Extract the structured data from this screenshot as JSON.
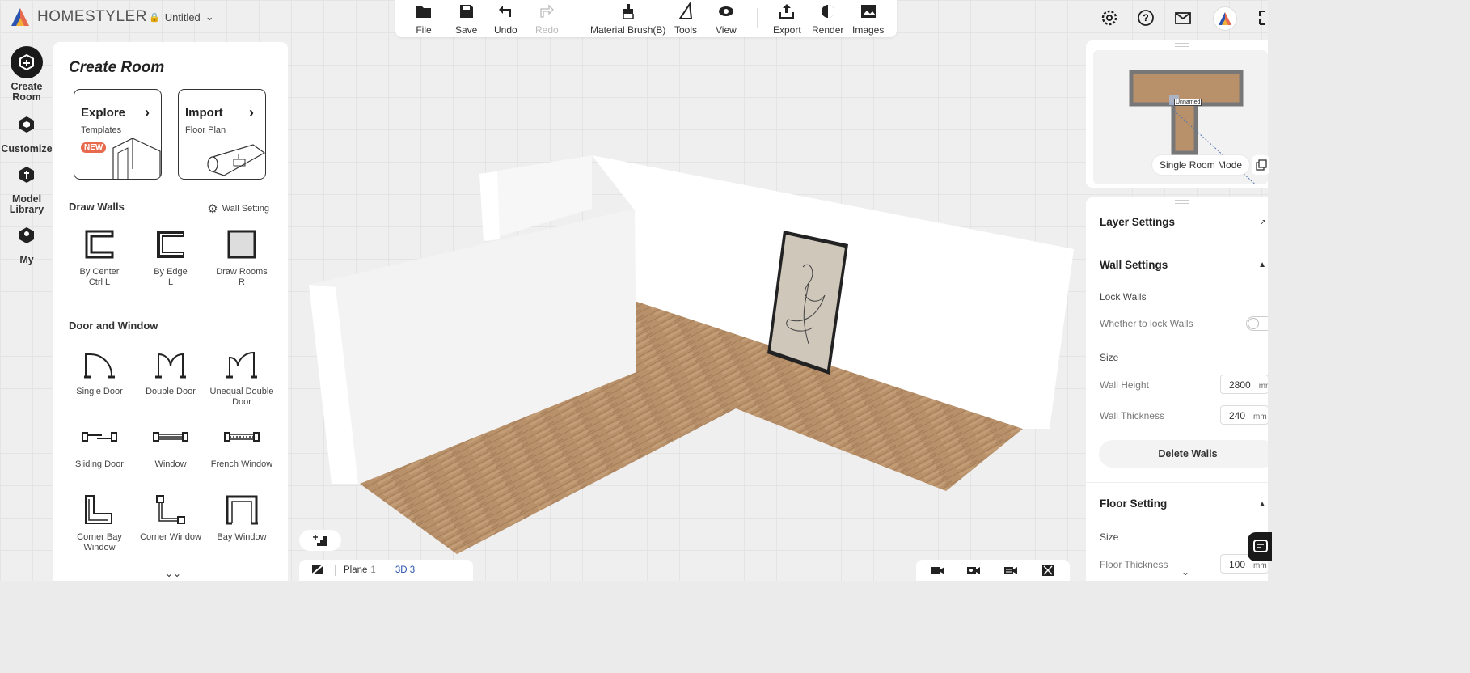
{
  "brand": {
    "name": "HOMESTYLER",
    "doc_title": "Untitled"
  },
  "toolbar": {
    "file": "File",
    "save": "Save",
    "undo": "Undo",
    "redo": "Redo",
    "material_brush": "Material Brush(B)",
    "tools": "Tools",
    "view": "View",
    "export": "Export",
    "render": "Render",
    "images": "Images"
  },
  "rail": [
    {
      "label": "Create Room",
      "icon": "create-room-icon"
    },
    {
      "label": "Customize",
      "icon": "cube-icon"
    },
    {
      "label": "Model Library",
      "icon": "model-library-icon"
    },
    {
      "label": "My",
      "icon": "user-icon"
    }
  ],
  "panel": {
    "title": "Create Room",
    "explore": {
      "title": "Explore",
      "sub": "Templates",
      "badge": "NEW"
    },
    "import": {
      "title": "Import",
      "sub": "Floor Plan"
    },
    "draw_walls": "Draw Walls",
    "wall_setting": "Wall Setting",
    "wall_tools": [
      {
        "label": "By Center",
        "shortcut": "Ctrl L"
      },
      {
        "label": "By Edge",
        "shortcut": "L"
      },
      {
        "label": "Draw Rooms",
        "shortcut": "R"
      }
    ],
    "door_window": "Door and Window",
    "dw_tools": [
      {
        "label": "Single Door"
      },
      {
        "label": "Double Door"
      },
      {
        "label": "Unequal Double Door"
      },
      {
        "label": "Sliding Door"
      },
      {
        "label": "Window"
      },
      {
        "label": "French Window"
      },
      {
        "label": "Corner Bay Window"
      },
      {
        "label": "Corner Window"
      },
      {
        "label": "Bay Window"
      }
    ]
  },
  "minimap": {
    "room_label": "Unnamed",
    "mode_button": "Single Room Mode"
  },
  "props": {
    "layer_settings": "Layer Settings",
    "wall_settings": "Wall Settings",
    "lock_walls": "Lock Walls",
    "lock_walls_desc": "Whether to lock Walls",
    "lock_walls_on": false,
    "size": "Size",
    "wall_height_label": "Wall Height",
    "wall_height": "2800",
    "wall_thickness_label": "Wall Thickness",
    "wall_thickness": "240",
    "unit": "mm",
    "delete_walls": "Delete Walls",
    "floor_setting": "Floor Setting",
    "floor_size": "Size",
    "floor_thickness_label": "Floor Thickness",
    "floor_thickness": "100"
  },
  "bottom": {
    "plane": "Plane",
    "plane_num": "1",
    "view3d": "3D",
    "view3d_num": "3"
  },
  "colors": {
    "accent": "#2b54b0",
    "badge": "#e86a4e",
    "floor": "#b48a62",
    "dark": "#1a1a1a"
  }
}
